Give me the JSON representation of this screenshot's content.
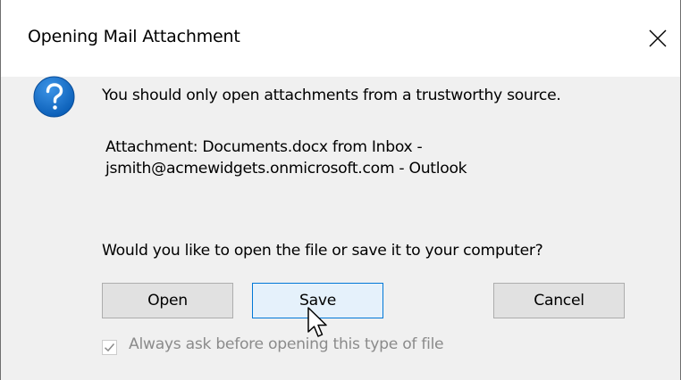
{
  "window": {
    "title": "Opening Mail Attachment"
  },
  "message": {
    "warning": "You should only open attachments from a trustworthy source.",
    "attachment_line1": "Attachment: Documents.docx from Inbox -",
    "attachment_line2": "jsmith@acmewidgets.onmicrosoft.com - Outlook",
    "question": "Would you like to open the file or save it to your computer?"
  },
  "buttons": {
    "open_label": "Open",
    "save_label": "Save",
    "cancel_label": "Cancel"
  },
  "options": {
    "always_ask_label": "Always ask before opening this type of file",
    "always_ask_checked": true,
    "always_ask_disabled": true
  },
  "icons": {
    "dialog_icon": "question-icon",
    "close_icon": "close-icon",
    "cursor": "pointer-cursor"
  },
  "colors": {
    "client_background": "#f0f0f0",
    "question_icon_blue": "#1470c8",
    "default_button_border": "#0078d7",
    "default_button_background": "#e5f1fb",
    "disabled_text": "#8b8b8b"
  }
}
